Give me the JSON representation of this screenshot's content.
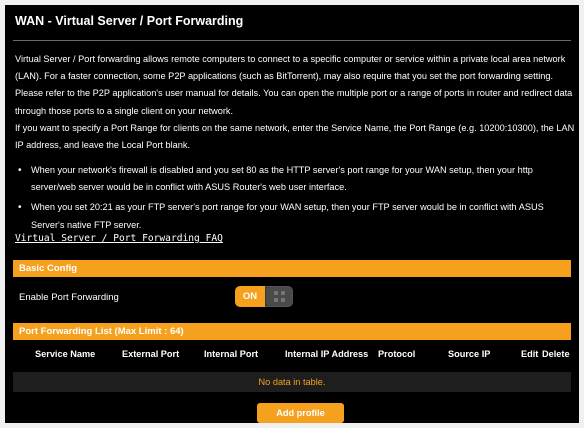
{
  "page": {
    "title": "WAN - Virtual Server / Port Forwarding"
  },
  "description": {
    "paragraph1": "Virtual Server / Port forwarding allows remote computers to connect to a specific computer or service within a private local area network (LAN). For a faster connection, some P2P applications (such as BitTorrent), may also require that you set the port forwarding setting. Please refer to the P2P application's user manual for details. You can open the multiple port or a range of ports in router and redirect data through those ports to a single client on your network.",
    "paragraph2": "If you want to specify a Port Range for clients on the same network, enter the Service Name, the Port Range (e.g. 10200:10300), the LAN IP address, and leave the Local Port blank."
  },
  "notes": [
    {
      "bullet": "•",
      "text": "When your network's firewall is disabled and you set 80 as the HTTP server's port range for your WAN setup, then your http server/web server would be in conflict with ASUS Router's web user interface."
    },
    {
      "bullet": "•",
      "text": "When you set 20:21 as your FTP server's port range for your WAN setup, then your FTP server would be in conflict with ASUS Server's native FTP server."
    }
  ],
  "faq_link": "Virtual Server / Port Forwarding FAQ",
  "basic_config": {
    "header": "Basic Config",
    "enable_label": "Enable Port Forwarding",
    "toggle_state": "ON"
  },
  "port_forwarding_list": {
    "header": "Port Forwarding List (Max Limit : 64)",
    "columns": [
      "Service Name",
      "External Port",
      "Internal Port",
      "Internal IP Address",
      "Protocol",
      "Source IP",
      "Edit",
      "Delete"
    ],
    "empty_message": "No data in table."
  },
  "add_profile_label": "Add profile",
  "colors": {
    "accent": "#f5a11e",
    "background": "#000000",
    "text": "#ffffff"
  }
}
